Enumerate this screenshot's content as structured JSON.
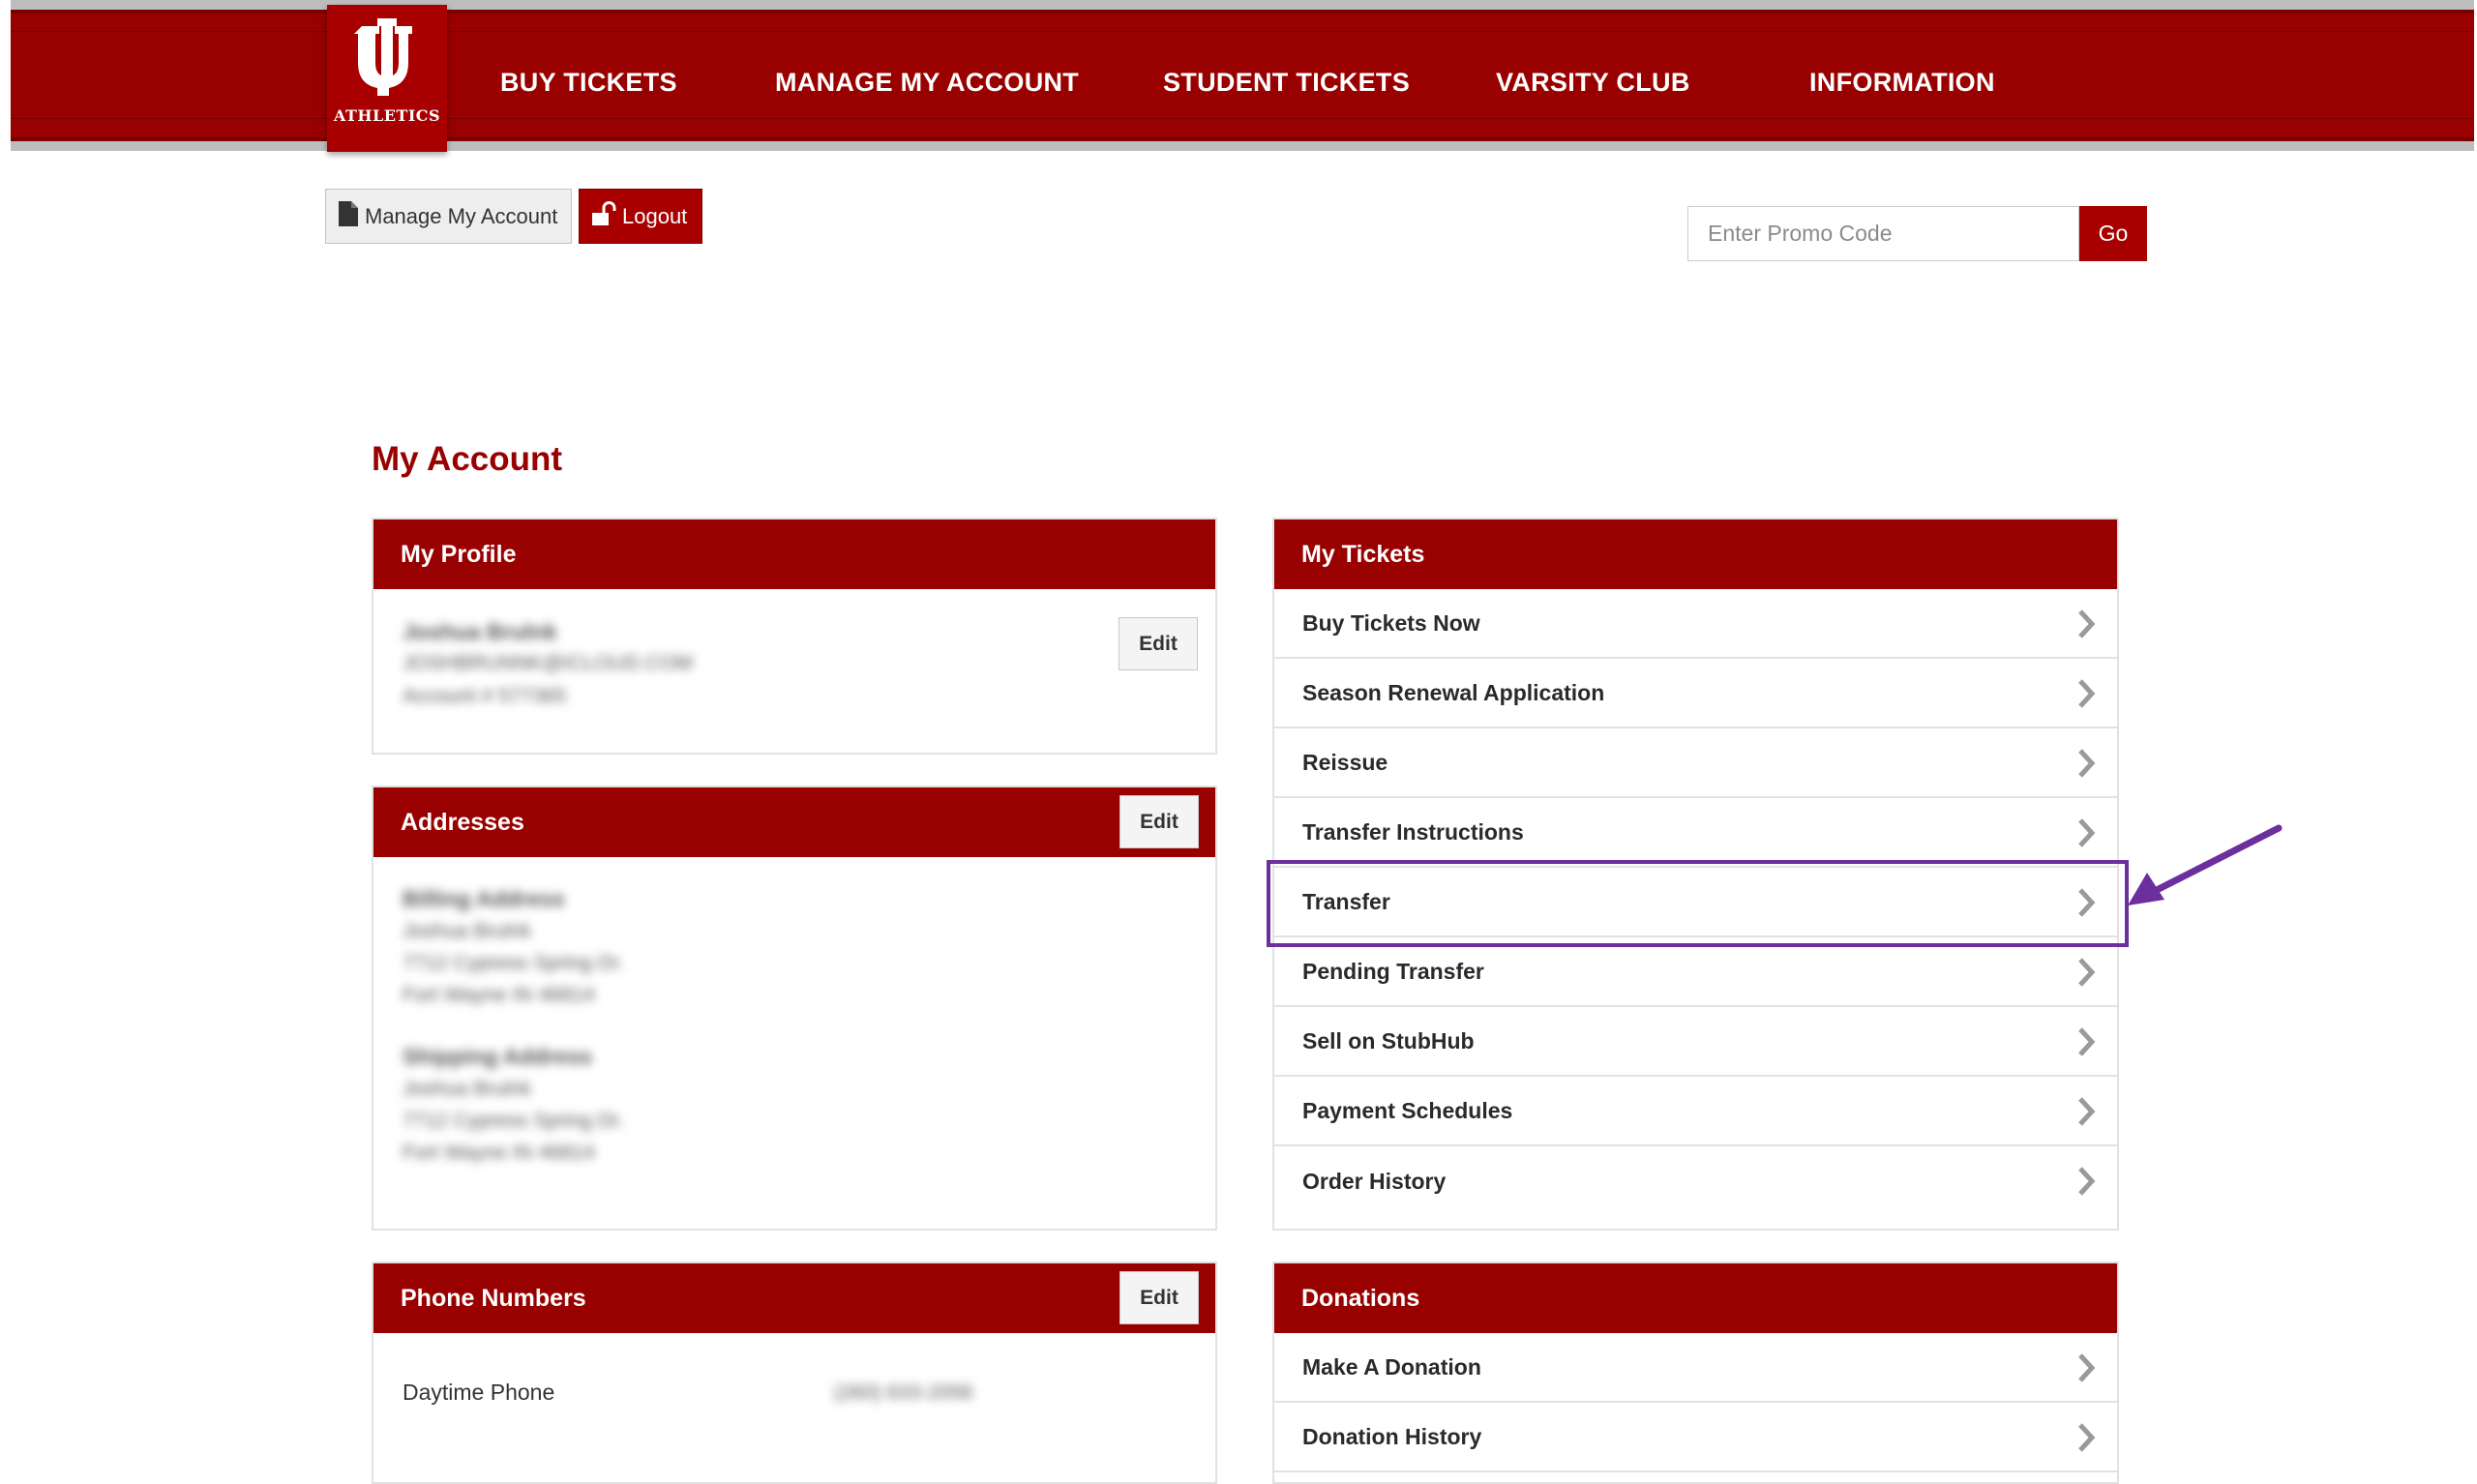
{
  "header": {
    "logo_text": "ATHLETICS",
    "nav": [
      "BUY TICKETS",
      "MANAGE MY ACCOUNT",
      "STUDENT TICKETS",
      "VARSITY CLUB",
      "INFORMATION"
    ]
  },
  "toolbar": {
    "manage_label": "Manage My Account",
    "logout_label": "Logout"
  },
  "promo": {
    "placeholder": "Enter Promo Code",
    "go_label": "Go"
  },
  "page_title": "My Account",
  "profile": {
    "title": "My Profile",
    "edit_label": "Edit",
    "name": "Joshua Brulnk",
    "email": "JOSHBRUNNK@ICLOUD.COM",
    "account": "Account # 577365"
  },
  "addresses": {
    "title": "Addresses",
    "edit_label": "Edit",
    "billing_heading": "Billing Address",
    "billing_lines": [
      "Joshua Brulnk",
      "7712 Cypress Spring Dr.",
      "Fort Wayne IN 46814"
    ],
    "shipping_heading": "Shipping Address",
    "shipping_lines": [
      "Joshua Brulnk",
      "7712 Cypress Spring Dr.",
      "Fort Wayne IN 46814"
    ]
  },
  "phones": {
    "title": "Phone Numbers",
    "edit_label": "Edit",
    "daytime_label": "Daytime Phone",
    "daytime_value": "(260) 633-2056"
  },
  "tickets": {
    "title": "My Tickets",
    "items": [
      "Buy Tickets Now",
      "Season Renewal Application",
      "Reissue",
      "Transfer Instructions",
      "Transfer",
      "Pending Transfer",
      "Sell on StubHub",
      "Payment Schedules",
      "Order History"
    ]
  },
  "donations": {
    "title": "Donations",
    "items": [
      "Make A Donation",
      "Donation History"
    ]
  },
  "colors": {
    "brand": "#990000",
    "highlight": "#6b2f9e"
  }
}
